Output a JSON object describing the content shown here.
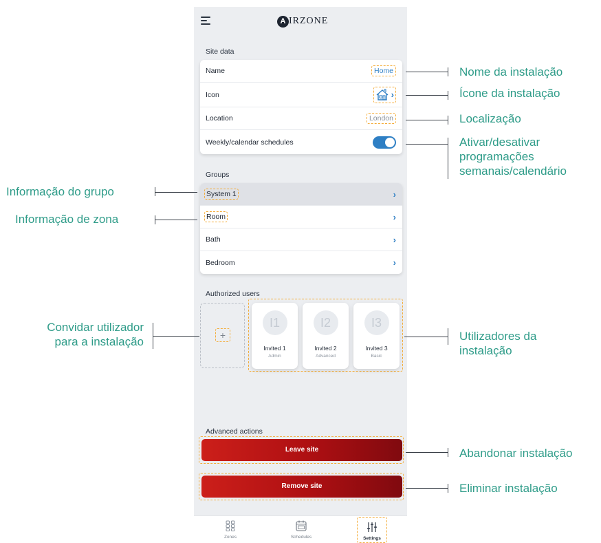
{
  "app": {
    "brand_mark": "A",
    "brand_text": "IRZONE"
  },
  "site_data": {
    "title": "Site data",
    "rows": [
      {
        "label": "Name",
        "value": "Home"
      },
      {
        "label": "Icon",
        "value": "house-icon"
      },
      {
        "label": "Location",
        "value": "London"
      },
      {
        "label": "Weekly/calendar schedules",
        "toggle": true
      }
    ]
  },
  "groups": {
    "title": "Groups",
    "items": [
      {
        "label": "System 1",
        "selected": true
      },
      {
        "label": "Room"
      },
      {
        "label": "Bath"
      },
      {
        "label": "Bedroom"
      }
    ]
  },
  "users": {
    "title": "Authorized users",
    "add_label": "+",
    "list": [
      {
        "initials": "I1",
        "name": "Invited 1",
        "role": "Admin"
      },
      {
        "initials": "I2",
        "name": "Invited 2",
        "role": "Advanced"
      },
      {
        "initials": "I3",
        "name": "Invited 3",
        "role": "Basic"
      }
    ]
  },
  "advanced": {
    "title": "Advanced actions",
    "leave_label": "Leave site",
    "remove_label": "Remove site"
  },
  "nav": {
    "items": [
      {
        "label": "Zones",
        "icon": "grid-icon"
      },
      {
        "label": "Schedules",
        "icon": "calendar-icon"
      },
      {
        "label": "Settings",
        "icon": "sliders-icon",
        "active": true
      }
    ]
  },
  "annotations": {
    "site_name": "Nome da instalação",
    "site_icon": "Ícone da instalação",
    "location": "Localização",
    "schedules_1": "Ativar/desativar",
    "schedules_2": "programações",
    "schedules_3": "semanais/calendário",
    "group_info": "Informação do grupo",
    "zone_info": "Informação de zona",
    "invite_1": "Convidar utilizador",
    "invite_2": "para a instalação",
    "site_users_1": "Utilizadores da",
    "site_users_2": "instalação",
    "leave": "Abandonar instalação",
    "remove": "Eliminar instalação"
  },
  "colors": {
    "accent": "#2e7fc4",
    "annotation": "#2f9c89",
    "highlight": "#f4ad3a",
    "danger": "#b3120f"
  }
}
